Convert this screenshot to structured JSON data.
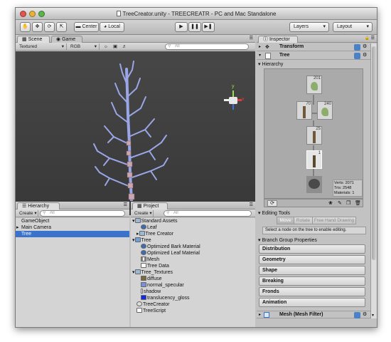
{
  "window": {
    "title": "TreeCreator.unity - TREECREATR - PC and Mac Standalone"
  },
  "toolbar": {
    "pivot_mode": "Center",
    "pivot_rotation": "Local",
    "layers_label": "Layers",
    "layout_label": "Layout"
  },
  "scene": {
    "tabs": [
      "Scene",
      "Game"
    ],
    "render_mode": "Textured",
    "color_mode": "RGB",
    "search_placeholder": "All",
    "gizmo_axes": {
      "y": "y",
      "x": "x"
    }
  },
  "hierarchy": {
    "tab": "Hierarchy",
    "create": "Create",
    "search_placeholder": "All",
    "items": [
      {
        "label": "GameObject"
      },
      {
        "label": "Main Camera"
      },
      {
        "label": "Tree",
        "selected": true
      }
    ]
  },
  "project": {
    "tab": "Project",
    "create": "Create",
    "search_placeholder": "All",
    "items": [
      {
        "label": "Standard Assets",
        "type": "folder"
      },
      {
        "label": "Leaf",
        "type": "material"
      },
      {
        "label": "Tree Creator",
        "type": "folder"
      },
      {
        "label": "Tree",
        "type": "tree"
      },
      {
        "label": "Optimized Bark Material",
        "type": "material"
      },
      {
        "label": "Optimized Leaf Material",
        "type": "material"
      },
      {
        "label": "Mesh",
        "type": "mesh"
      },
      {
        "label": "Tree Data",
        "type": "file"
      },
      {
        "label": "Tree_Textures",
        "type": "folder"
      },
      {
        "label": "diffuse",
        "type": "texture"
      },
      {
        "label": "normal_specular",
        "type": "texture"
      },
      {
        "label": "shadow",
        "type": "texture"
      },
      {
        "label": "translucency_gloss",
        "type": "texture"
      },
      {
        "label": "TreeCreator",
        "type": "script"
      },
      {
        "label": "TreeScript",
        "type": "file"
      }
    ]
  },
  "inspector": {
    "tab": "Inspector",
    "transform_label": "Transform",
    "tree_label": "Tree",
    "hierarchy_heading": "Hierarchy",
    "nodes": [
      {
        "count": "201",
        "kind": "leaf-group"
      },
      {
        "count": "70",
        "kind": "branch-group"
      },
      {
        "count": "240",
        "kind": "leaf-group"
      },
      {
        "count": "25",
        "kind": "branch-group"
      },
      {
        "count": "1",
        "kind": "branch-group"
      },
      {
        "count": "",
        "kind": "root"
      }
    ],
    "stats": {
      "verts": "Verts: 2071",
      "tris": "Tris: 2548",
      "materials": "Materials: 1"
    },
    "editing_tools": {
      "heading": "Editing Tools",
      "buttons": [
        "Move",
        "Rotate",
        "Free Hand Drawing"
      ],
      "hint": "Select a node on the tree to enable editing."
    },
    "branch_group": {
      "heading": "Branch Group Properties",
      "sections": [
        "Distribution",
        "Geometry",
        "Shape",
        "Breaking",
        "Fronds",
        "Animation"
      ]
    },
    "mesh_filter_label": "Mesh (Mesh Filter)"
  },
  "colors": {
    "selection": "#3b72cc",
    "viewport": "#3f3f3f",
    "panel": "#c2c2c2"
  }
}
